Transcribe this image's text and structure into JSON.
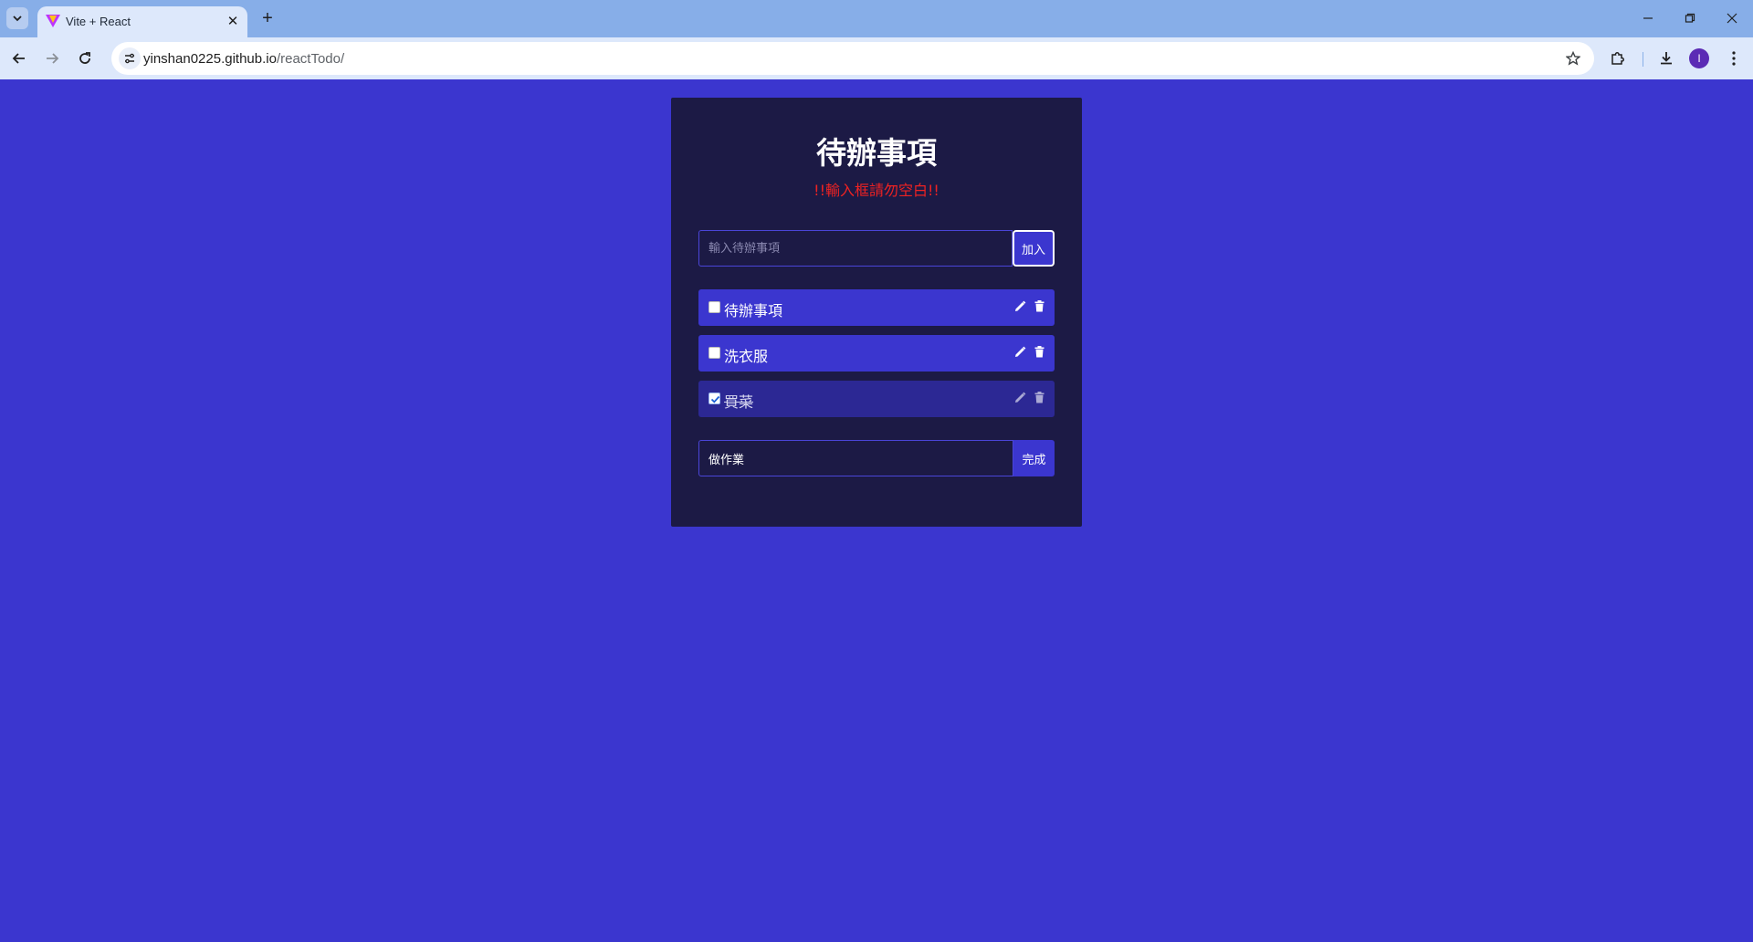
{
  "browser": {
    "tab_title": "Vite + React",
    "url_host": "yinshan0225.github.io",
    "url_path": "/reactTodo/",
    "avatar_letter": "I"
  },
  "app": {
    "title": "待辦事項",
    "warning": "!!輸入框請勿空白!!",
    "add_placeholder": "輸入待辦事項",
    "add_label": "加入",
    "todos": [
      {
        "text": "待辦事項",
        "done": false
      },
      {
        "text": "洗衣服",
        "done": false
      },
      {
        "text": "買菜",
        "done": true
      }
    ],
    "edit_value": "做作業",
    "edit_confirm_label": "完成"
  },
  "colors": {
    "page_bg": "#3b36cf",
    "card_bg": "#1c1a45",
    "item_bg": "#3b36cf",
    "warning": "#ee2222"
  },
  "icons": {
    "edit": "pencil-icon",
    "delete": "trash-icon"
  }
}
